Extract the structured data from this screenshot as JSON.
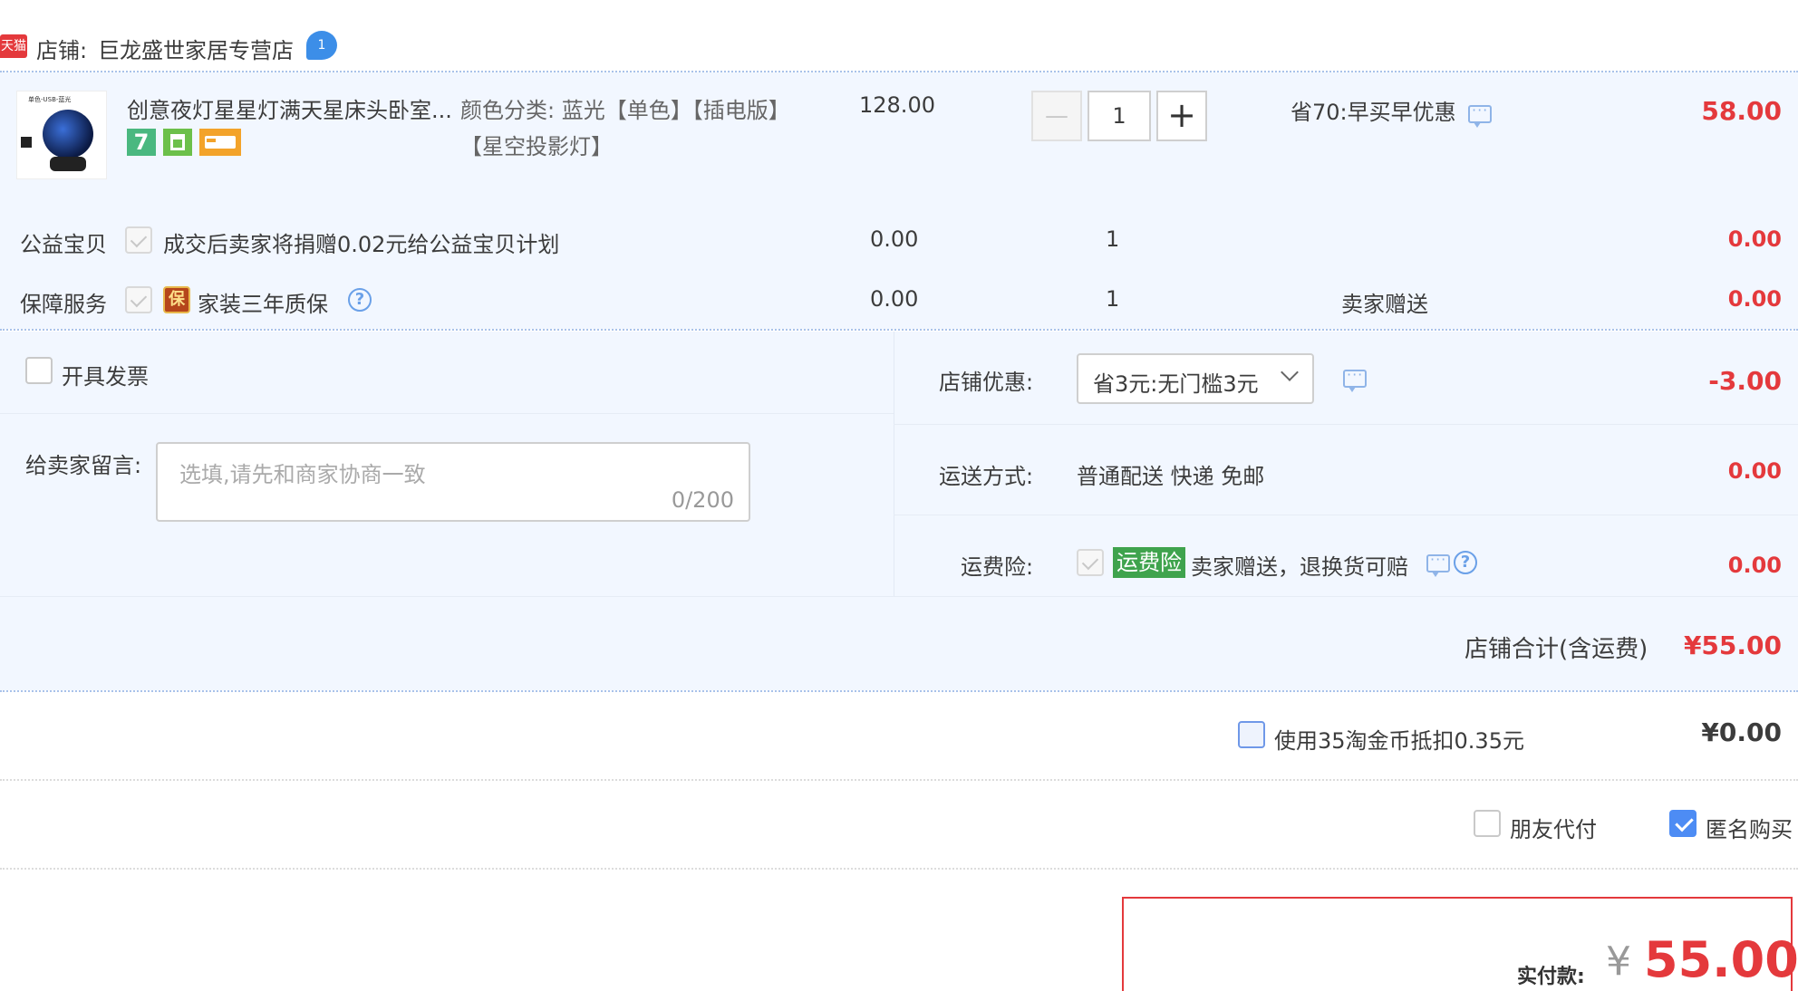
{
  "colors": {
    "accent_red": "#e4393c",
    "light_blue_bg": "#f2f7ff",
    "blue_check": "#4d8cf4",
    "insurance_green": "#3fa34d"
  },
  "shop": {
    "badge": "天猫",
    "label": "店铺:",
    "name": "巨龙盛世家居专营店",
    "chat_icon": "wangwang-chat-icon"
  },
  "product": {
    "thumb_text": "单色-USB-蓝光",
    "title": "创意夜灯星星灯满天星床头卧室...",
    "sku_label": "颜色分类:",
    "sku_value": "蓝光【单色】【插电版】【星空投影灯】",
    "badges": [
      "7",
      "store-icon",
      "card-icon"
    ],
    "price": "128.00",
    "qty": "1",
    "qty_minus": "—",
    "qty_plus": "+",
    "promo": "省70:早买早优惠",
    "total": "58.00"
  },
  "charity": {
    "label": "公益宝贝",
    "desc": "成交后卖家将捐赠0.02元给公益宝贝计划",
    "price": "0.00",
    "qty": "1",
    "total": "0.00"
  },
  "warranty": {
    "label": "保障服务",
    "badge": "保",
    "desc": "家装三年质保",
    "price": "0.00",
    "qty": "1",
    "note": "卖家赠送",
    "total": "0.00"
  },
  "invoice": {
    "label": "开具发票"
  },
  "message": {
    "label": "给卖家留言:",
    "placeholder": "选填,请先和商家协商一致",
    "counter": "0/200"
  },
  "shop_discount": {
    "label": "店铺优惠:",
    "selected": "省3元:无门槛3元",
    "value": "-3.00"
  },
  "shipping": {
    "label": "运送方式:",
    "value": "普通配送 快递 免邮",
    "price": "0.00"
  },
  "shipping_insurance": {
    "label": "运费险:",
    "tag": "运费险",
    "desc": "卖家赠送，退换货可赔",
    "price": "0.00"
  },
  "shop_total": {
    "label": "店铺合计(含运费)",
    "value": "¥55.00"
  },
  "coins": {
    "label": "使用35淘金币抵扣0.35元",
    "value": "¥0.00"
  },
  "options": {
    "friend_pay": "朋友代付",
    "anonymous": "匿名购买"
  },
  "pay": {
    "label": "实付款:",
    "currency": "¥",
    "amount": "55.00"
  }
}
